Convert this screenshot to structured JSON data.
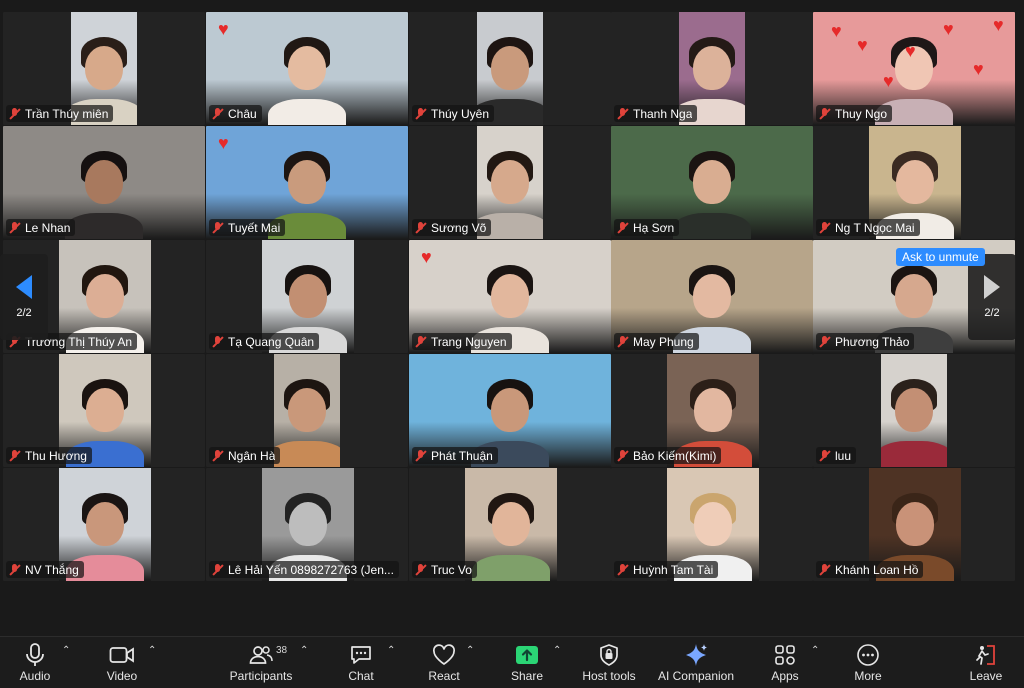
{
  "participants": [
    {
      "name": "Trần Thúy miên",
      "skin": "#d7a98a",
      "hair": "#2a1e18",
      "shirt": "#d9d2c3",
      "bg": "#cfd3d8",
      "video": "narrow"
    },
    {
      "name": "Châu",
      "skin": "#e4bba0",
      "hair": "#201814",
      "shirt": "#f2ece6",
      "bg": "#bcc9d2",
      "video": "full",
      "heart": true
    },
    {
      "name": "Thúy Uyên",
      "skin": "#c99a7c",
      "hair": "#1e1512",
      "shirt": "#2a2a2a",
      "bg": "#c8cbcf",
      "video": "narrow"
    },
    {
      "name": "Thanh Nga",
      "skin": "#dcb29a",
      "hair": "#241a16",
      "shirt": "#e7d6cf",
      "bg": "#9b6c8e",
      "video": "narrow"
    },
    {
      "name": "Thuy Ngo",
      "skin": "#f0c6b4",
      "hair": "#1f1717",
      "shirt": "#c8b0b5",
      "bg": "#e79a9a",
      "video": "full",
      "hearts": true
    },
    {
      "name": "Le Nhan",
      "skin": "#a8795e",
      "hair": "#151010",
      "shirt": "#2d2a2a",
      "bg": "#8e8a86",
      "video": "full"
    },
    {
      "name": "Tuyết Mai",
      "skin": "#c99b7d",
      "hair": "#1d1512",
      "shirt": "#6a8c3a",
      "bg": "#6fa4d8",
      "video": "full",
      "heart": true
    },
    {
      "name": "Sương Võ",
      "skin": "#d6a98c",
      "hair": "#221812",
      "shirt": "#b9b0a8",
      "bg": "#d7d2cb",
      "video": "narrow"
    },
    {
      "name": "Hạ Sơn",
      "skin": "#d9ad91",
      "hair": "#1b1412",
      "shirt": "#2a2f2a",
      "bg": "#4c6a4a",
      "video": "full"
    },
    {
      "name": "Ng T Ngọc Mai",
      "skin": "#e4b89e",
      "hair": "#3a2a22",
      "shirt": "#f1ece6",
      "bg": "#c9b58e",
      "video": "mid"
    },
    {
      "name": "Trương Thị Thúy An",
      "skin": "#dcae95",
      "hair": "#21160f",
      "shirt": "#f5f1ec",
      "bg": "#c7c2bb",
      "video": "mid"
    },
    {
      "name": "Tạ Quang Quân",
      "skin": "#c28f72",
      "hair": "#171210",
      "shirt": "#d8d8d8",
      "bg": "#cfd2d4",
      "video": "mid"
    },
    {
      "name": "Trang Nguyen",
      "skin": "#e2b79d",
      "hair": "#1a1412",
      "shirt": "#e9e3dc",
      "bg": "#d7d1ca",
      "video": "full",
      "heart": true
    },
    {
      "name": "May Phung",
      "skin": "#e3b9a1",
      "hair": "#1a1412",
      "shirt": "#cfd6e0",
      "bg": "#b7a58a",
      "video": "full"
    },
    {
      "name": "Phương Thảo",
      "skin": "#d6a88e",
      "hair": "#1b1411",
      "shirt": "#3e3e3e",
      "bg": "#d2ccc3",
      "video": "full"
    },
    {
      "name": "Thu Hương",
      "skin": "#dcae92",
      "hair": "#1a1310",
      "shirt": "#3a6fd1",
      "bg": "#cfc8bd",
      "video": "mid"
    },
    {
      "name": "Ngân Hà",
      "skin": "#c9987a",
      "hair": "#1d1511",
      "shirt": "#c88a56",
      "bg": "#b7b0a6",
      "video": "narrow"
    },
    {
      "name": "Phát Thuận",
      "skin": "#c9987a",
      "hair": "#171210",
      "shirt": "#3b4a5c",
      "bg": "#6fb3dc",
      "video": "full"
    },
    {
      "name": "Bảo Kiếm(Kimi)",
      "skin": "#e2b7a0",
      "hair": "#2c1f18",
      "shirt": "#d34d3a",
      "bg": "#7a6355",
      "video": "mid"
    },
    {
      "name": "luu",
      "skin": "#c38f74",
      "hair": "#2b211b",
      "shirt": "#9a2a3a",
      "bg": "#d6d2cd",
      "video": "narrow"
    },
    {
      "name": "NV Thắng",
      "skin": "#c9977b",
      "hair": "#1a1413",
      "shirt": "#e58c9a",
      "bg": "#cfd3d8",
      "video": "mid"
    },
    {
      "name": "Lê Hải Yến 0898272763 (Jen...",
      "skin": "#bdbdbd",
      "hair": "#222222",
      "shirt": "#e8e8e8",
      "bg": "#9a9a9a",
      "video": "mid"
    },
    {
      "name": "Truc Vo",
      "skin": "#e1b59a",
      "hair": "#201612",
      "shirt": "#7fa06a",
      "bg": "#c9b9a8",
      "video": "mid"
    },
    {
      "name": "Huỳnh Tam Tài",
      "skin": "#efcdb8",
      "hair": "#caa56e",
      "shirt": "#f0f0f0",
      "bg": "#d9c7b4",
      "video": "mid"
    },
    {
      "name": "Khánh Loan Hồ",
      "skin": "#c99278",
      "hair": "#3a2518",
      "shirt": "#7a4a2a",
      "bg": "#4e3324",
      "video": "mid"
    }
  ],
  "pager": {
    "left_label": "2/2",
    "right_label": "2/2"
  },
  "unmute_prompt": "Ask to unmute",
  "toolbar": {
    "audio": "Audio",
    "video": "Video",
    "participants": "Participants",
    "participants_count": "38",
    "chat": "Chat",
    "react": "React",
    "share": "Share",
    "host_tools": "Host tools",
    "ai_companion": "AI Companion",
    "apps": "Apps",
    "more": "More",
    "leave": "Leave"
  },
  "colors": {
    "share": "#2bd575",
    "ai": "#7aa7ff",
    "leave": "#e0433b",
    "accent": "#2d8cff"
  }
}
